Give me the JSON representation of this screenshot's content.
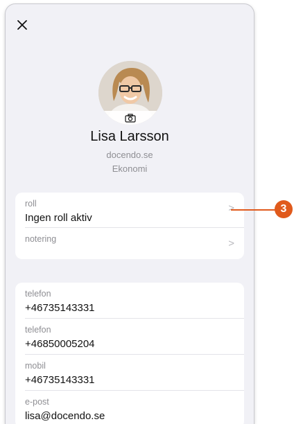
{
  "profile": {
    "name": "Lisa Larsson",
    "company": "docendo.se",
    "department": "Ekonomi"
  },
  "role_card": {
    "items": [
      {
        "label": "roll",
        "value": "Ingen roll aktiv"
      },
      {
        "label": "notering",
        "value": ""
      }
    ]
  },
  "contact_card": {
    "items": [
      {
        "label": "telefon",
        "value": "+46735143331"
      },
      {
        "label": "telefon",
        "value": "+46850005204"
      },
      {
        "label": "mobil",
        "value": "+46735143331"
      },
      {
        "label": "e-post",
        "value": "lisa@docendo.se"
      }
    ]
  },
  "callout": {
    "number": "3",
    "color": "#e05a1c"
  },
  "icons": {
    "close": "close-icon",
    "camera": "camera-icon",
    "chevron": "chevron-right-icon"
  }
}
